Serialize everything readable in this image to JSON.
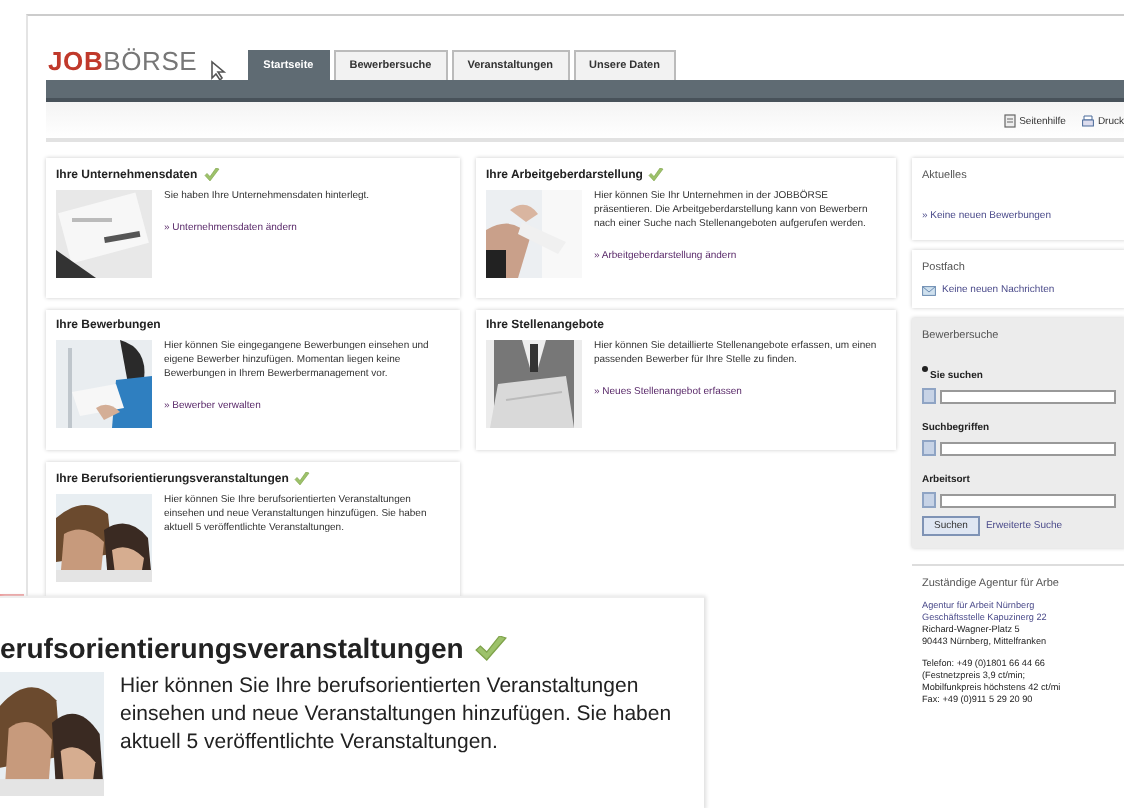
{
  "header": {
    "logo": {
      "part_1": "JOB",
      "part_2": "BÖRSE"
    },
    "tabs": [
      {
        "label": "Startseite",
        "selected": true
      },
      {
        "label": "Bewerbersuche",
        "selected": false
      },
      {
        "label": "Veranstaltungen",
        "selected": false
      },
      {
        "label": "Unsere Daten",
        "selected": false
      }
    ]
  },
  "toolbar": [
    {
      "label": "Seitenhilfe",
      "kind": "help"
    },
    {
      "label": "Druck",
      "kind": "print"
    }
  ],
  "cards": [
    {
      "title": "Ihre Unternehmensdaten",
      "checked": true,
      "text": "Sie haben Ihre Unternehmensdaten hinterlegt.",
      "link": "» Unternehmensdaten ändern"
    },
    {
      "title": "Ihre Arbeitgeberdarstellung",
      "checked": true,
      "text": "Hier können Sie Ihr Unternehmen in der JOBBÖRSE präsentieren. Die Arbeitgeberdarstellung kann von Bewerbern nach einer Suche nach Stellenangeboten aufgerufen werden.",
      "link": "» Arbeitgeberdarstellung ändern"
    },
    {
      "title": "Ihre Bewerbungen",
      "checked": false,
      "text": "Hier können Sie eingegangene Bewerbungen einsehen und eigene Bewerber hinzufügen. Momentan liegen keine Bewerbungen in Ihrem Bewerbermanagement vor.",
      "link": "» Bewerber verwalten"
    },
    {
      "title": "Ihre Stellenangebote",
      "checked": false,
      "text": "Hier können Sie detaillierte Stellenangebote erfassen, um einen passenden Bewerber für Ihre Stelle zu finden.",
      "link": "» Neues Stellenangebot erfassen"
    },
    {
      "title": "Ihre Berufsorientierungsveranstaltungen",
      "checked": true,
      "text": "Hier können Sie Ihre berufsorientierten Veranstaltungen einsehen und neue Veranstaltungen hinzufügen. Sie haben aktuell 5 veröffentlichte Veranstaltungen."
    }
  ],
  "sidebar": {
    "news": {
      "title": "Aktuelles",
      "link": "» Keine neuen Bewerbungen"
    },
    "inbox": {
      "title": "Postfach",
      "link": "Keine neuen Nachrichten"
    },
    "search": {
      "title": "Bewerbersuche",
      "fields": [
        {
          "label": "Sie suchen",
          "required": true
        },
        {
          "label": "Suchbegriffen",
          "required": false
        },
        {
          "label": "Arbeitsort",
          "required": false
        }
      ],
      "button": "Suchen",
      "link": "Erweiterte Suche"
    },
    "agency": {
      "title": "Zuständige Agentur für Arbe",
      "links": [
        "Agentur für Arbeit Nürnberg",
        "Geschäftsstelle Kapuzinerg 22"
      ],
      "address": [
        "Richard-Wagner-Platz 5",
        "90443 Nürnberg, Mittelfranken"
      ],
      "contact": [
        "Telefon: +49 (0)1801 66 44 66",
        "(Festnetzpreis 3,9 ct/min;",
        "Mobilfunkpreis höchstens 42 ct/mi",
        "Fax: +49 (0)911 5 29 20 90"
      ]
    }
  },
  "inset": {
    "title": "erufsorientierungsveranstaltungen",
    "checked": true,
    "text": "Hier können Sie Ihre berufsorientierten Veranstaltungen einsehen und neue Veranstaltungen hinzufügen. Sie haben aktuell 5 veröffentlichte Veranstaltungen."
  }
}
